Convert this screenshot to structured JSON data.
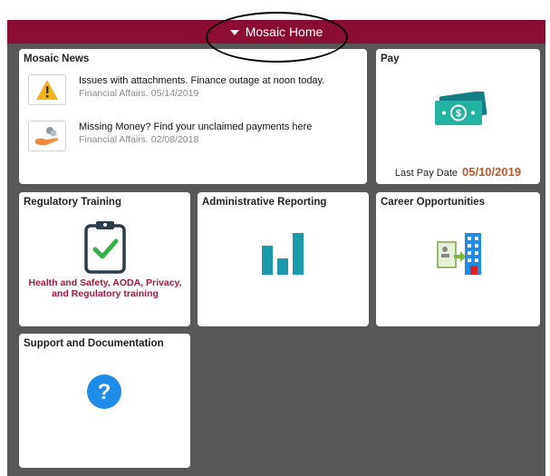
{
  "banner": {
    "title": "Mosaic Home"
  },
  "tiles": {
    "news": {
      "title": "Mosaic News",
      "items": [
        {
          "headline": "Issues with attachments. Finance outage at noon today.",
          "meta": "Financial Affairs. 05/14/2019",
          "icon": "warning-icon"
        },
        {
          "headline": "Missing Money? Find your unclaimed payments here",
          "meta": "Financial Affairs. 02/08/2018",
          "icon": "coins-hand-icon"
        }
      ]
    },
    "pay": {
      "title": "Pay",
      "last_pay_label": "Last Pay Date",
      "last_pay_date": "05/10/2019",
      "icon": "money-icon"
    },
    "regulatory": {
      "title": "Regulatory Training",
      "caption_line1": "Health and Safety, AODA, Privacy,",
      "caption_line2": "and Regulatory training",
      "icon": "clipboard-check-icon"
    },
    "reporting": {
      "title": "Administrative Reporting",
      "icon": "bar-chart-icon"
    },
    "careers": {
      "title": "Career Opportunities",
      "icon": "career-building-icon"
    },
    "support": {
      "title": "Support and Documentation",
      "icon": "help-icon"
    }
  },
  "colors": {
    "banner": "#8b0d33",
    "background": "#585858",
    "accent_teal": "#1a9aaa",
    "date_orange": "#c15a2b",
    "caption_red": "#a21a3f",
    "help_blue": "#1f8ce8"
  }
}
